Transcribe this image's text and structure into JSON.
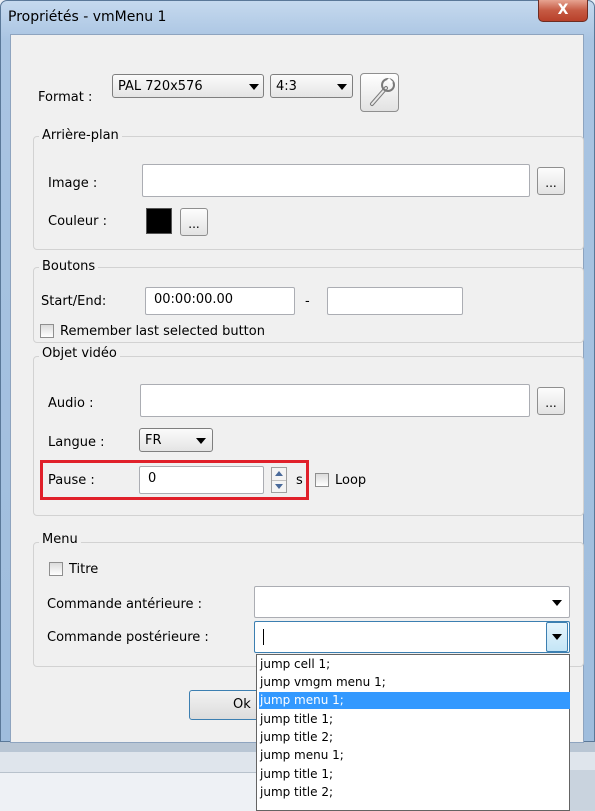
{
  "window": {
    "title": "Propriétés - vmMenu 1",
    "close_label": "X"
  },
  "format": {
    "label": "Format :",
    "resolution_value": "PAL 720x576",
    "aspect_value": "4:3"
  },
  "background_group": {
    "title": "Arrière-plan",
    "image_label": "Image :",
    "image_value": "",
    "browse_label": "...",
    "color_label": "Couleur :",
    "color_swatch": "#000000",
    "color_button_label": "..."
  },
  "buttons_group": {
    "title": "Boutons",
    "start_end_label": "Start/End:",
    "start_value": "00:00:00.00",
    "separator": "-",
    "end_value": "",
    "remember_label": "Remember last selected button",
    "remember_checked": false
  },
  "video_group": {
    "title": "Objet vidéo",
    "audio_label": "Audio :",
    "audio_value": "",
    "audio_browse_label": "...",
    "language_label": "Langue :",
    "language_value": "FR",
    "pause_label": "Pause :",
    "pause_value": "0",
    "pause_unit": "s",
    "loop_label": "Loop",
    "loop_checked": false,
    "highlight_color": "#e0202a"
  },
  "menu_group": {
    "title": "Menu",
    "title_checkbox_label": "Titre",
    "title_checked": false,
    "pre_command_label": "Commande antérieure :",
    "pre_command_value": "",
    "post_command_label": "Commande postérieure :",
    "post_command_value": ""
  },
  "ok_button_label": "Ok",
  "dropdown": {
    "items": [
      "jump cell 1;",
      "jump vmgm menu 1;",
      "jump menu 1;",
      "jump title 1;",
      "jump title 2;",
      "jump menu 1;",
      "jump title 1;",
      "jump title 2;"
    ],
    "selected_index": 2
  },
  "colors": {
    "selection": "#3399ff",
    "dialog_bg": "#f0f0f0",
    "frame": "#a9c4e2"
  }
}
